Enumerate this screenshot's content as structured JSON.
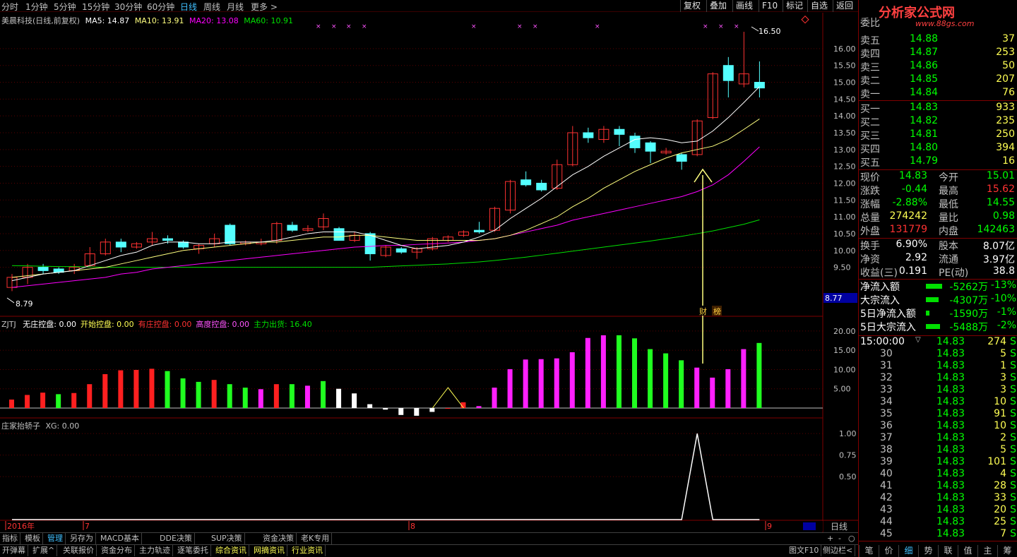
{
  "toolbar": {
    "periods": [
      "分时",
      "1分钟",
      "5分钟",
      "15分钟",
      "30分钟",
      "60分钟",
      "日线",
      "周线",
      "月线",
      "更多 >"
    ],
    "active_period": "日线",
    "right_buttons": [
      "复权",
      "叠加",
      "画线",
      "F10",
      "标记",
      "自选",
      "返回"
    ]
  },
  "main_chart": {
    "title": "美晨科技(日线,前复权)",
    "ma5": "MA5: 14.87",
    "ma10": "MA10: 13.91",
    "ma20": "MA20: 13.08",
    "ma60": "MA60: 10.91",
    "high_marker": "16.50",
    "low_marker": "8.79",
    "price_badge": "8.77",
    "tags": [
      "财",
      "榜"
    ]
  },
  "colors": {
    "up": "#ff3232",
    "down": "#54ffff",
    "ma5": "#ffffff",
    "ma10": "#ffff7f",
    "ma20": "#ff00ff",
    "ma60": "#00e000",
    "grid": "#800000",
    "accent": "#40c0ff"
  },
  "indicator1": {
    "name": "ZJTJ",
    "labels": [
      {
        "text": "无庄控盘: 0.00",
        "color": "#ffffff"
      },
      {
        "text": "开始控盘: 0.00",
        "color": "#ffff54"
      },
      {
        "text": "有庄控盘: 0.00",
        "color": "#ff3232"
      },
      {
        "text": "高度控盘: 0.00",
        "color": "#ff54ff"
      },
      {
        "text": "主力出货: 16.40",
        "color": "#00e000"
      }
    ]
  },
  "indicator2": {
    "name": "庄家抬轿子",
    "xg": "XG: 0.00"
  },
  "chart_data": [
    {
      "type": "candlestick",
      "title": "美晨科技(日线,前复权)",
      "y_axis_ticks": [
        "16.00",
        "15.50",
        "15.00",
        "14.50",
        "14.00",
        "13.50",
        "13.00",
        "12.50",
        "12.00",
        "11.50",
        "11.00",
        "10.50",
        "10.00",
        "9.50"
      ],
      "ylim": [
        8.4,
        16.9
      ],
      "candles": [
        {
          "o": 8.9,
          "c": 9.2,
          "h": 9.3,
          "l": 8.79
        },
        {
          "o": 9.2,
          "c": 9.5,
          "h": 9.6,
          "l": 9.0
        },
        {
          "o": 9.5,
          "c": 9.4,
          "h": 9.6,
          "l": 9.3
        },
        {
          "o": 9.45,
          "c": 9.35,
          "h": 9.5,
          "l": 9.3
        },
        {
          "o": 9.4,
          "c": 9.5,
          "h": 9.6,
          "l": 9.3
        },
        {
          "o": 9.55,
          "c": 9.9,
          "h": 10.1,
          "l": 9.5
        },
        {
          "o": 9.9,
          "c": 10.25,
          "h": 10.35,
          "l": 9.85
        },
        {
          "o": 10.25,
          "c": 10.1,
          "h": 10.35,
          "l": 9.95
        },
        {
          "o": 10.1,
          "c": 10.2,
          "h": 10.25,
          "l": 10.05
        },
        {
          "o": 10.25,
          "c": 10.35,
          "h": 10.55,
          "l": 10.15
        },
        {
          "o": 10.35,
          "c": 10.3,
          "h": 10.45,
          "l": 10.2
        },
        {
          "o": 10.25,
          "c": 10.1,
          "h": 10.3,
          "l": 10.05
        },
        {
          "o": 10.05,
          "c": 10.15,
          "h": 10.2,
          "l": 9.9
        },
        {
          "o": 10.2,
          "c": 10.35,
          "h": 10.5,
          "l": 10.1
        },
        {
          "o": 10.75,
          "c": 10.2,
          "h": 10.8,
          "l": 10.15
        },
        {
          "o": 10.2,
          "c": 10.25,
          "h": 10.3,
          "l": 10.15
        },
        {
          "o": 10.2,
          "c": 10.25,
          "h": 10.35,
          "l": 10.15
        },
        {
          "o": 10.3,
          "c": 10.8,
          "h": 10.85,
          "l": 10.2
        },
        {
          "o": 10.75,
          "c": 10.6,
          "h": 10.85,
          "l": 10.55
        },
        {
          "o": 10.6,
          "c": 10.65,
          "h": 10.75,
          "l": 10.55
        },
        {
          "o": 10.7,
          "c": 10.95,
          "h": 11.1,
          "l": 10.6
        },
        {
          "o": 10.65,
          "c": 10.3,
          "h": 10.7,
          "l": 10.3
        },
        {
          "o": 10.3,
          "c": 10.45,
          "h": 10.55,
          "l": 10.25
        },
        {
          "o": 10.5,
          "c": 9.9,
          "h": 10.55,
          "l": 9.7
        },
        {
          "o": 9.85,
          "c": 10.1,
          "h": 10.15,
          "l": 9.8
        },
        {
          "o": 10.05,
          "c": 9.95,
          "h": 10.1,
          "l": 9.9
        },
        {
          "o": 9.95,
          "c": 10.05,
          "h": 10.1,
          "l": 9.75
        },
        {
          "o": 10.05,
          "c": 10.35,
          "h": 10.4,
          "l": 10.0
        },
        {
          "o": 10.3,
          "c": 10.4,
          "h": 10.45,
          "l": 10.25
        },
        {
          "o": 10.45,
          "c": 10.55,
          "h": 10.6,
          "l": 10.4
        },
        {
          "o": 10.6,
          "c": 10.55,
          "h": 10.85,
          "l": 10.5
        },
        {
          "o": 10.6,
          "c": 11.25,
          "h": 11.3,
          "l": 10.55
        },
        {
          "o": 11.2,
          "c": 12.05,
          "h": 12.1,
          "l": 11.1
        },
        {
          "o": 12.1,
          "c": 11.95,
          "h": 12.35,
          "l": 11.9
        },
        {
          "o": 12.0,
          "c": 11.8,
          "h": 12.1,
          "l": 11.75
        },
        {
          "o": 11.85,
          "c": 12.55,
          "h": 12.7,
          "l": 11.8
        },
        {
          "o": 12.55,
          "c": 13.5,
          "h": 13.7,
          "l": 12.5
        },
        {
          "o": 13.5,
          "c": 13.35,
          "h": 13.65,
          "l": 13.2
        },
        {
          "o": 13.3,
          "c": 13.6,
          "h": 13.7,
          "l": 13.2
        },
        {
          "o": 13.6,
          "c": 13.45,
          "h": 13.7,
          "l": 13.1
        },
        {
          "o": 13.4,
          "c": 13.05,
          "h": 13.5,
          "l": 12.9
        },
        {
          "o": 13.2,
          "c": 12.95,
          "h": 13.25,
          "l": 12.6
        },
        {
          "o": 12.9,
          "c": 12.95,
          "h": 13.05,
          "l": 12.85
        },
        {
          "o": 12.85,
          "c": 12.65,
          "h": 12.9,
          "l": 12.4
        },
        {
          "o": 12.85,
          "c": 13.85,
          "h": 13.9,
          "l": 12.8
        },
        {
          "o": 13.95,
          "c": 15.25,
          "h": 15.3,
          "l": 13.9
        },
        {
          "o": 15.5,
          "c": 15.05,
          "h": 15.75,
          "l": 14.55
        },
        {
          "o": 14.95,
          "c": 15.25,
          "h": 16.5,
          "l": 14.85
        },
        {
          "o": 15.0,
          "c": 14.83,
          "h": 15.62,
          "l": 14.55
        }
      ],
      "ma5": [
        9.1,
        9.2,
        9.3,
        9.35,
        9.4,
        9.55,
        9.7,
        9.85,
        9.95,
        10.15,
        10.25,
        10.25,
        10.2,
        10.2,
        10.25,
        10.25,
        10.25,
        10.3,
        10.4,
        10.5,
        10.55,
        10.55,
        10.55,
        10.45,
        10.3,
        10.15,
        10.05,
        10.1,
        10.15,
        10.25,
        10.4,
        10.6,
        10.95,
        11.25,
        11.55,
        11.9,
        12.25,
        12.5,
        12.8,
        13.05,
        13.3,
        13.35,
        13.3,
        13.2,
        13.25,
        13.55,
        13.95,
        14.4,
        14.87
      ],
      "ma10": [
        9.2,
        9.25,
        9.3,
        9.35,
        9.4,
        9.45,
        9.5,
        9.6,
        9.7,
        9.8,
        9.9,
        10.0,
        10.05,
        10.1,
        10.15,
        10.2,
        10.25,
        10.25,
        10.3,
        10.35,
        10.4,
        10.4,
        10.45,
        10.45,
        10.4,
        10.35,
        10.3,
        10.3,
        10.3,
        10.3,
        10.3,
        10.35,
        10.45,
        10.6,
        10.8,
        11.0,
        11.3,
        11.55,
        11.85,
        12.1,
        12.35,
        12.55,
        12.75,
        12.9,
        13.0,
        13.1,
        13.3,
        13.6,
        13.91
      ],
      "ma20": [
        8.9,
        8.95,
        9.0,
        9.05,
        9.1,
        9.15,
        9.2,
        9.3,
        9.35,
        9.45,
        9.5,
        9.55,
        9.6,
        9.65,
        9.7,
        9.75,
        9.8,
        9.85,
        9.9,
        9.95,
        10.0,
        10.05,
        10.1,
        10.12,
        10.15,
        10.15,
        10.18,
        10.2,
        10.22,
        10.25,
        10.3,
        10.35,
        10.45,
        10.55,
        10.65,
        10.75,
        10.9,
        11.0,
        11.1,
        11.2,
        11.3,
        11.4,
        11.5,
        11.6,
        11.75,
        11.95,
        12.25,
        12.65,
        13.08
      ],
      "ma60": [
        9.55,
        9.54,
        9.53,
        9.52,
        9.52,
        9.51,
        9.5,
        9.5,
        9.5,
        9.5,
        9.5,
        9.5,
        9.5,
        9.5,
        9.5,
        9.5,
        9.5,
        9.5,
        9.5,
        9.5,
        9.5,
        9.5,
        9.5,
        9.5,
        9.52,
        9.54,
        9.56,
        9.58,
        9.6,
        9.63,
        9.66,
        9.7,
        9.75,
        9.8,
        9.86,
        9.92,
        9.98,
        10.04,
        10.1,
        10.16,
        10.22,
        10.28,
        10.35,
        10.42,
        10.5,
        10.58,
        10.68,
        10.78,
        10.91
      ]
    },
    {
      "type": "bar",
      "name": "ZJTJ",
      "y_axis_ticks": [
        "20.00",
        "15.00",
        "10.00",
        "5.00"
      ],
      "ylim": [
        0,
        22
      ],
      "values": [
        2.2,
        3.4,
        4.0,
        3.6,
        3.9,
        6.2,
        8.8,
        9.8,
        9.9,
        10.2,
        9.6,
        7.7,
        6.8,
        7.3,
        6.2,
        5.3,
        4.9,
        6.2,
        6.2,
        5.8,
        7.0,
        5.0,
        3.8,
        1.0,
        -0.4,
        -1.8,
        -2.0,
        -1.0,
        0.0,
        1.5,
        0.5,
        5.3,
        10.1,
        12.6,
        12.7,
        12.9,
        14.5,
        18.2,
        18.9,
        18.9,
        18.1,
        15.3,
        14.2,
        12.4,
        10.5,
        7.9,
        10.1,
        15.3,
        16.9,
        17.8,
        16.4
      ],
      "colors": [
        "r",
        "r",
        "r",
        "g",
        "r",
        "r",
        "r",
        "r",
        "r",
        "r",
        "g",
        "g",
        "g",
        "r",
        "g",
        "g",
        "m",
        "r",
        "g",
        "m",
        "g",
        "w",
        "w",
        "w",
        "w",
        "w",
        "w",
        "w",
        "r",
        "r",
        "m",
        "m",
        "m",
        "m",
        "m",
        "m",
        "m",
        "m",
        "m",
        "g",
        "g",
        "g",
        "g",
        "g",
        "m",
        "m",
        "m",
        "m",
        "g"
      ]
    },
    {
      "type": "line",
      "name": "庄家抬轿子",
      "y_axis_ticks": [
        "1.00",
        "0.75",
        "0.50"
      ],
      "ylim": [
        0,
        1.1
      ],
      "values": [
        0,
        0,
        0,
        0,
        0,
        0,
        0,
        0,
        0,
        0,
        0,
        0,
        0,
        0,
        0,
        0,
        0,
        0,
        0,
        0,
        0,
        0,
        0,
        0,
        0,
        0,
        0,
        0,
        0,
        0,
        0,
        0,
        0,
        0,
        0,
        0,
        0,
        0,
        0,
        0,
        0,
        0,
        0,
        0,
        1,
        0,
        0,
        0,
        0
      ]
    }
  ],
  "x_axis": {
    "labels": [
      "2016年",
      "7",
      "8",
      "9"
    ],
    "period_label": "日线"
  },
  "quote": {
    "title": "委比",
    "sells": [
      {
        "label": "卖五",
        "price": "14.88",
        "vol": "37"
      },
      {
        "label": "卖四",
        "price": "14.87",
        "vol": "253"
      },
      {
        "label": "卖三",
        "price": "14.86",
        "vol": "50"
      },
      {
        "label": "卖二",
        "price": "14.85",
        "vol": "207"
      },
      {
        "label": "卖一",
        "price": "14.84",
        "vol": "76"
      }
    ],
    "buys": [
      {
        "label": "买一",
        "price": "14.83",
        "vol": "933"
      },
      {
        "label": "买二",
        "price": "14.82",
        "vol": "235"
      },
      {
        "label": "买三",
        "price": "14.81",
        "vol": "250"
      },
      {
        "label": "买四",
        "price": "14.80",
        "vol": "394"
      },
      {
        "label": "买五",
        "price": "14.79",
        "vol": "16"
      }
    ],
    "stats": [
      {
        "l1": "现价",
        "v1": "14.83",
        "c1": "#00ff00",
        "l2": "今开",
        "v2": "15.01",
        "c2": "#00ff00"
      },
      {
        "l1": "涨跌",
        "v1": "-0.44",
        "c1": "#00ff00",
        "l2": "最高",
        "v2": "15.62",
        "c2": "#ff3232"
      },
      {
        "l1": "涨幅",
        "v1": "-2.88%",
        "c1": "#00ff00",
        "l2": "最低",
        "v2": "14.55",
        "c2": "#00ff00"
      },
      {
        "l1": "总量",
        "v1": "274242",
        "c1": "#ffff54",
        "l2": "量比",
        "v2": "0.98",
        "c2": "#00ff00"
      },
      {
        "l1": "外盘",
        "v1": "131779",
        "c1": "#ff3232",
        "l2": "内盘",
        "v2": "142463",
        "c2": "#00ff00"
      }
    ],
    "stats2": [
      {
        "l1": "换手",
        "v1": "6.90%",
        "l2": "股本",
        "v2": "8.07亿"
      },
      {
        "l1": "净资",
        "v1": "2.92",
        "l2": "流通",
        "v2": "3.97亿"
      },
      {
        "l1": "收益(三)",
        "v1": "0.191",
        "l2": "PE(动)",
        "v2": "38.8"
      }
    ],
    "flows": [
      {
        "label": "净流入额",
        "value": "-5262万",
        "pct": "-13%",
        "bar": 0.45
      },
      {
        "label": "大宗流入",
        "value": "-4307万",
        "pct": "-10%",
        "bar": 0.35
      },
      {
        "label": "5日净流入额",
        "value": "-1590万",
        "pct": "-1%",
        "bar": 0.1
      },
      {
        "label": "5日大宗流入",
        "value": "-5488万",
        "pct": "-2%",
        "bar": 0.4
      }
    ],
    "ticks_header": {
      "time": "15:00:00",
      "price": "14.83",
      "vol": "274",
      "flag": "S"
    },
    "ticks": [
      {
        "t": "30",
        "p": "14.83",
        "v": "5",
        "f": "S"
      },
      {
        "t": "31",
        "p": "14.83",
        "v": "1",
        "f": "S"
      },
      {
        "t": "32",
        "p": "14.83",
        "v": "3",
        "f": "S"
      },
      {
        "t": "33",
        "p": "14.83",
        "v": "3",
        "f": "S"
      },
      {
        "t": "34",
        "p": "14.83",
        "v": "10",
        "f": "S"
      },
      {
        "t": "35",
        "p": "14.83",
        "v": "91",
        "f": "S"
      },
      {
        "t": "36",
        "p": "14.83",
        "v": "10",
        "f": "S"
      },
      {
        "t": "37",
        "p": "14.83",
        "v": "2",
        "f": "S"
      },
      {
        "t": "38",
        "p": "14.83",
        "v": "5",
        "f": "S"
      },
      {
        "t": "39",
        "p": "14.83",
        "v": "101",
        "f": "S"
      },
      {
        "t": "40",
        "p": "14.83",
        "v": "4",
        "f": "S"
      },
      {
        "t": "41",
        "p": "14.83",
        "v": "28",
        "f": "S"
      },
      {
        "t": "42",
        "p": "14.83",
        "v": "33",
        "f": "S"
      },
      {
        "t": "43",
        "p": "14.83",
        "v": "20",
        "f": "S"
      },
      {
        "t": "44",
        "p": "14.83",
        "v": "25",
        "f": "S"
      },
      {
        "t": "45",
        "p": "14.83",
        "v": "7",
        "f": "S"
      }
    ],
    "tick_tabs": [
      "笔",
      "价",
      "细",
      "势",
      "联",
      "值",
      "主",
      "筹"
    ],
    "active_tick_tab": "细"
  },
  "watermark": {
    "text": "分析家公式网",
    "url": "www.88gs.com"
  },
  "bottom_tabs_row1": [
    "指标",
    "模板",
    "管理",
    "另存为",
    "MACD基本",
    "DDE决策",
    "SUP决策",
    "资金决策",
    "老K专用"
  ],
  "bottom_tabs_row1_active": "管理",
  "bottom_tabs_row2": [
    "开弹幕",
    "扩展^",
    "关联报价",
    "资金分布",
    "主力轨迹",
    "逐笔委托",
    "综合资讯",
    "网摘资讯",
    "行业资讯"
  ],
  "bottom_right": {
    "f10": "图文F10",
    "sidebar": "侧边栏<"
  }
}
